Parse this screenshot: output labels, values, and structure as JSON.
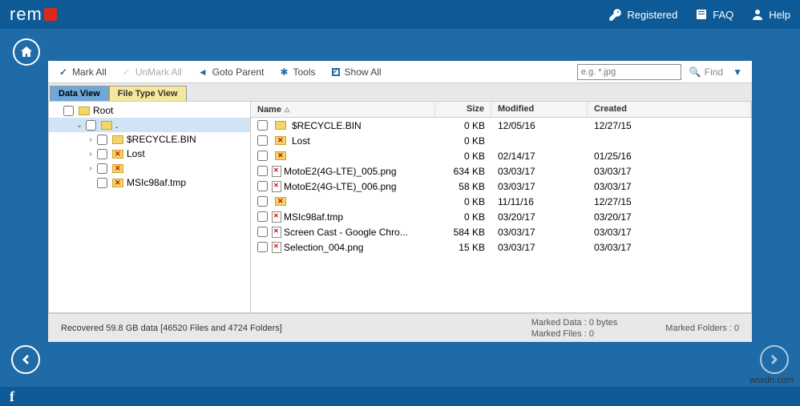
{
  "app": {
    "logo_text": "rem"
  },
  "topbar": {
    "registered": "Registered",
    "faq": "FAQ",
    "help": "Help"
  },
  "toolbar": {
    "mark_all": "Mark All",
    "unmark_all": "UnMark All",
    "goto_parent": "Goto Parent",
    "tools": "Tools",
    "show_all": "Show All",
    "search_placeholder": "e.g. *.jpg",
    "find": "Find"
  },
  "tabs": {
    "data_view": "Data View",
    "file_type_view": "File Type View"
  },
  "tree": {
    "root": "Root",
    "dot": ".",
    "recycle": "$RECYCLE.BIN",
    "lost": "Lost",
    "blank": " ",
    "tmp": "MSIc98af.tmp"
  },
  "list": {
    "headers": {
      "name": "Name",
      "size": "Size",
      "modified": "Modified",
      "created": "Created"
    },
    "rows": [
      {
        "name": "$RECYCLE.BIN",
        "size": "0 KB",
        "modified": "12/05/16",
        "created": "12/27/15",
        "type": "folder"
      },
      {
        "name": "Lost",
        "size": "0 KB",
        "modified": "",
        "created": "",
        "type": "folder-del"
      },
      {
        "name": "",
        "size": "0 KB",
        "modified": "02/14/17",
        "created": "01/25/16",
        "type": "folder-del"
      },
      {
        "name": "MotoE2(4G-LTE)_005.png",
        "size": "634 KB",
        "modified": "03/03/17",
        "created": "03/03/17",
        "type": "file-del"
      },
      {
        "name": "MotoE2(4G-LTE)_006.png",
        "size": "58 KB",
        "modified": "03/03/17",
        "created": "03/03/17",
        "type": "file-del"
      },
      {
        "name": "",
        "size": "0 KB",
        "modified": "11/11/16",
        "created": "12/27/15",
        "type": "folder-del"
      },
      {
        "name": "MSIc98af.tmp",
        "size": "0 KB",
        "modified": "03/20/17",
        "created": "03/20/17",
        "type": "file-del"
      },
      {
        "name": "Screen Cast - Google Chro...",
        "size": "584 KB",
        "modified": "03/03/17",
        "created": "03/03/17",
        "type": "file-del"
      },
      {
        "name": "Selection_004.png",
        "size": "15 KB",
        "modified": "03/03/17",
        "created": "03/03/17",
        "type": "file-del"
      }
    ]
  },
  "status": {
    "recovered": "Recovered 59.8 GB data [46520 Files and 4724 Folders]",
    "marked_data": "Marked Data : 0 bytes",
    "marked_files": "Marked Files : 0",
    "marked_folders": "Marked Folders : 0"
  },
  "watermark": "wsxdn.com"
}
